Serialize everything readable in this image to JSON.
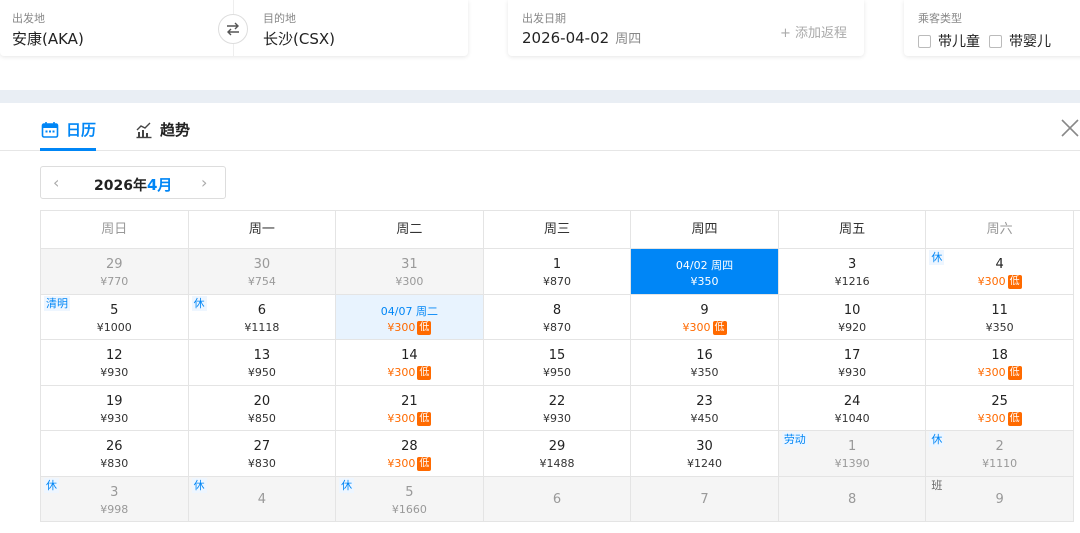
{
  "search": {
    "origin_label": "出发地",
    "origin_value": "安康(AKA)",
    "dest_label": "目的地",
    "dest_value": "长沙(CSX)",
    "date_label": "出发日期",
    "date_value": "2026-04-02",
    "date_weekday": "周四",
    "add_return": "+ 添加返程",
    "passenger_label": "乘客类型",
    "child_label": "带儿童",
    "infant_label": "带婴儿"
  },
  "tabs": {
    "calendar": "日历",
    "trend": "趋势"
  },
  "month": {
    "year": "2026年",
    "month": "4月"
  },
  "weekdays": [
    "周日",
    "周一",
    "周二",
    "周三",
    "周四",
    "周五",
    "周六"
  ],
  "low_badge": "低",
  "weeks": [
    [
      {
        "day": "29",
        "price": "¥770",
        "out": true
      },
      {
        "day": "30",
        "price": "¥754",
        "out": true
      },
      {
        "day": "31",
        "price": "¥300",
        "out": true
      },
      {
        "day": "1",
        "price": "¥870"
      },
      {
        "day": "04/02 周四",
        "price": "¥350",
        "selected": true
      },
      {
        "day": "3",
        "price": "¥1216"
      },
      {
        "day": "4",
        "price": "¥300",
        "low": true,
        "tag": "休"
      }
    ],
    [
      {
        "day": "5",
        "price": "¥1000",
        "tag": "清明"
      },
      {
        "day": "6",
        "price": "¥1118",
        "tag": "休"
      },
      {
        "day": "04/07 周二",
        "price": "¥300",
        "low": true,
        "highlight": true
      },
      {
        "day": "8",
        "price": "¥870"
      },
      {
        "day": "9",
        "price": "¥300",
        "low": true
      },
      {
        "day": "10",
        "price": "¥920"
      },
      {
        "day": "11",
        "price": "¥350"
      }
    ],
    [
      {
        "day": "12",
        "price": "¥930"
      },
      {
        "day": "13",
        "price": "¥950"
      },
      {
        "day": "14",
        "price": "¥300",
        "low": true
      },
      {
        "day": "15",
        "price": "¥950"
      },
      {
        "day": "16",
        "price": "¥350"
      },
      {
        "day": "17",
        "price": "¥930"
      },
      {
        "day": "18",
        "price": "¥300",
        "low": true
      }
    ],
    [
      {
        "day": "19",
        "price": "¥930"
      },
      {
        "day": "20",
        "price": "¥850"
      },
      {
        "day": "21",
        "price": "¥300",
        "low": true
      },
      {
        "day": "22",
        "price": "¥930"
      },
      {
        "day": "23",
        "price": "¥450"
      },
      {
        "day": "24",
        "price": "¥1040"
      },
      {
        "day": "25",
        "price": "¥300",
        "low": true
      }
    ],
    [
      {
        "day": "26",
        "price": "¥830"
      },
      {
        "day": "27",
        "price": "¥830"
      },
      {
        "day": "28",
        "price": "¥300",
        "low": true
      },
      {
        "day": "29",
        "price": "¥1488"
      },
      {
        "day": "30",
        "price": "¥1240"
      },
      {
        "day": "1",
        "price": "¥1390",
        "out": true,
        "tag": "劳动"
      },
      {
        "day": "2",
        "price": "¥1110",
        "out": true,
        "tag": "休"
      }
    ],
    [
      {
        "day": "3",
        "price": "¥998",
        "out": true,
        "tag": "休"
      },
      {
        "day": "4",
        "price": "",
        "out": true,
        "tag": "休"
      },
      {
        "day": "5",
        "price": "¥1660",
        "out": true,
        "tag": "休"
      },
      {
        "day": "6",
        "price": "",
        "out": true
      },
      {
        "day": "7",
        "price": "",
        "out": true
      },
      {
        "day": "8",
        "price": "",
        "out": true
      },
      {
        "day": "9",
        "price": "",
        "out": true,
        "tag": "班",
        "tag_work": true
      }
    ]
  ],
  "colors": {
    "accent": "#0086f6",
    "low_price": "#ff6a00",
    "tab_band": "#e9eef4"
  }
}
